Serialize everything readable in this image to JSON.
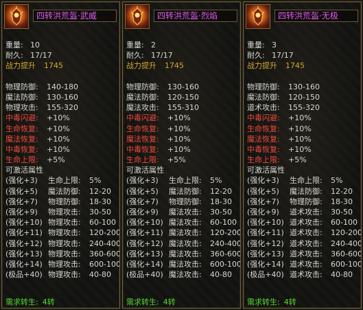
{
  "panels": [
    {
      "name": "四转洪荒盔·武威",
      "weight_label": "重量:",
      "weight": "10",
      "durability_label": "耐久:",
      "durability": "17/17",
      "power_label": "战力提升",
      "power": "1745",
      "base_stats": [
        {
          "label": "物理防御:",
          "value": "140-180"
        },
        {
          "label": "魔法防御:",
          "value": "130-160"
        },
        {
          "label": "物理攻击:",
          "value": "155-320"
        }
      ],
      "bonus_stats": [
        {
          "label": "中毒闪避:",
          "value": "+10%"
        },
        {
          "label": "生命恢复:",
          "value": "+10%"
        },
        {
          "label": "魔法恢复:",
          "value": "+10%"
        },
        {
          "label": "中毒恢复:",
          "value": "+10%"
        },
        {
          "label": "生命上限:",
          "value": "+5%"
        }
      ],
      "activatable_label": "可激活属性",
      "enhance": [
        {
          "lvl": "(强化+3)",
          "label": "生命上限:",
          "value": "5%"
        },
        {
          "lvl": "(强化+5)",
          "label": "魔法防御:",
          "value": "12-20"
        },
        {
          "lvl": "(强化+7)",
          "label": "物理防御:",
          "value": "18-30"
        },
        {
          "lvl": "(强化+9)",
          "label": "物理攻击:",
          "value": "30-50"
        },
        {
          "lvl": "(强化+10)",
          "label": "物理攻击:",
          "value": "60-100"
        },
        {
          "lvl": "(强化+11)",
          "label": "物理攻击:",
          "value": "120-200"
        },
        {
          "lvl": "(强化+12)",
          "label": "物理攻击:",
          "value": "240-400"
        },
        {
          "lvl": "(强化+13)",
          "label": "物理攻击:",
          "value": "360-600"
        },
        {
          "lvl": "(强化+14)",
          "label": "物理攻击:",
          "value": "600-1000"
        },
        {
          "lvl": "(极品+40)",
          "label": "物理攻击:",
          "value": "40-80"
        }
      ],
      "req_label": "需求转生:",
      "req_value": "4转"
    },
    {
      "name": "四转洪荒盔·烈焰",
      "weight_label": "重量:",
      "weight": "2",
      "durability_label": "耐久:",
      "durability": "17/17",
      "power_label": "战力提升",
      "power": "1745",
      "base_stats": [
        {
          "label": "物理防御:",
          "value": "130-160"
        },
        {
          "label": "魔法防御:",
          "value": "120-150"
        },
        {
          "label": "魔法攻击:",
          "value": "155-310"
        }
      ],
      "bonus_stats": [
        {
          "label": "中毒闪避:",
          "value": "+10%"
        },
        {
          "label": "生命恢复:",
          "value": "+10%"
        },
        {
          "label": "魔法恢复:",
          "value": "+10%"
        },
        {
          "label": "中毒恢复:",
          "value": "+10%"
        },
        {
          "label": "生命上限:",
          "value": "+5%"
        }
      ],
      "activatable_label": "可激活属性",
      "enhance": [
        {
          "lvl": "(强化+3)",
          "label": "生命上限:",
          "value": "5%"
        },
        {
          "lvl": "(强化+5)",
          "label": "魔法防御:",
          "value": "12-20"
        },
        {
          "lvl": "(强化+7)",
          "label": "物理防御:",
          "value": "18-30"
        },
        {
          "lvl": "(强化+9)",
          "label": "魔法攻击:",
          "value": "30-50"
        },
        {
          "lvl": "(强化+10)",
          "label": "魔法攻击:",
          "value": "60-100"
        },
        {
          "lvl": "(强化+11)",
          "label": "魔法攻击:",
          "value": "120-200"
        },
        {
          "lvl": "(强化+12)",
          "label": "魔法攻击:",
          "value": "240-400"
        },
        {
          "lvl": "(强化+13)",
          "label": "魔法攻击:",
          "value": "360-600"
        },
        {
          "lvl": "(强化+14)",
          "label": "魔法攻击:",
          "value": "600-1000"
        },
        {
          "lvl": "(极品+40)",
          "label": "魔法攻击:",
          "value": "40-80"
        }
      ],
      "req_label": "需求转生:",
      "req_value": "4转"
    },
    {
      "name": "四转洪荒盔·无极",
      "weight_label": "重量:",
      "weight": "3",
      "durability_label": "耐久:",
      "durability": "17/17",
      "power_label": "战力提升",
      "power": "1745",
      "base_stats": [
        {
          "label": "物理防御:",
          "value": "130-160"
        },
        {
          "label": "魔法防御:",
          "value": "120-150"
        },
        {
          "label": "道术攻击:",
          "value": "155-320"
        }
      ],
      "bonus_stats": [
        {
          "label": "中毒闪避:",
          "value": "+10%"
        },
        {
          "label": "生命恢复:",
          "value": "+10%"
        },
        {
          "label": "魔法恢复:",
          "value": "+10%"
        },
        {
          "label": "中毒恢复:",
          "value": "+10%"
        },
        {
          "label": "生命上限:",
          "value": "+5%"
        }
      ],
      "activatable_label": "可激活属性",
      "enhance": [
        {
          "lvl": "(强化+3)",
          "label": "生命上限:",
          "value": "5%"
        },
        {
          "lvl": "(强化+5)",
          "label": "魔法防御:",
          "value": "12-20"
        },
        {
          "lvl": "(强化+7)",
          "label": "物理防御:",
          "value": "18-30"
        },
        {
          "lvl": "(强化+9)",
          "label": "道术攻击:",
          "value": "30-50"
        },
        {
          "lvl": "(强化+10)",
          "label": "道术攻击:",
          "value": "60-100"
        },
        {
          "lvl": "(强化+11)",
          "label": "道术攻击:",
          "value": "120-200"
        },
        {
          "lvl": "(强化+12)",
          "label": "道术攻击:",
          "value": "240-400"
        },
        {
          "lvl": "(强化+13)",
          "label": "道术攻击:",
          "value": "360-600"
        },
        {
          "lvl": "(强化+14)",
          "label": "道术攻击:",
          "value": "600-1000"
        },
        {
          "lvl": "(极品+40)",
          "label": "道术攻击:",
          "value": "40-80"
        }
      ],
      "req_label": "需求转生:",
      "req_value": "4转"
    }
  ],
  "icons": {
    "item": "helmet-icon"
  },
  "colors": {
    "name": "#e25bf0",
    "gold": "#d6a72c",
    "red": "#f04a3a",
    "green": "#54d830",
    "white": "#d8d8d0"
  }
}
